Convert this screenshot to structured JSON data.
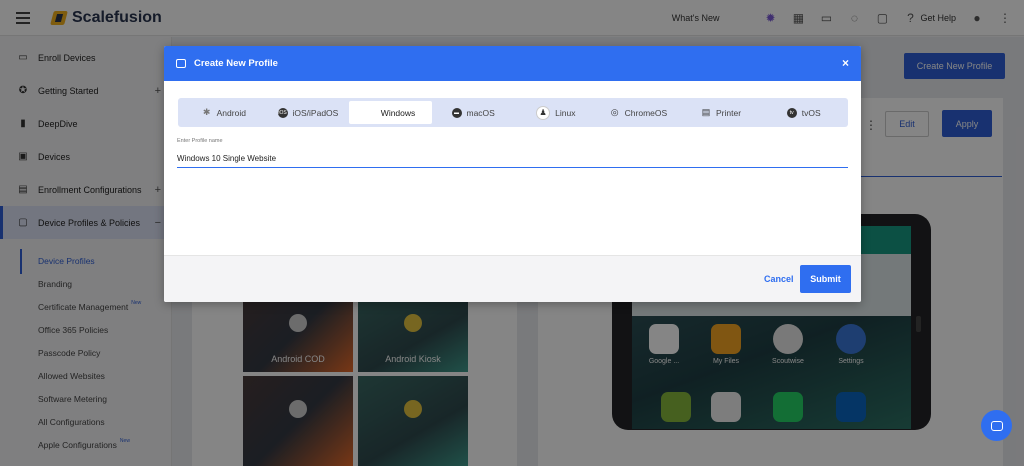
{
  "topbar": {
    "brand": "Scalefusion",
    "whats_new": "What's New",
    "help": "Get Help",
    "icons": [
      "hamburger-icon",
      "sparkle-icon",
      "grid-icon",
      "cast-icon",
      "loading-icon",
      "chat-icon",
      "help-icon",
      "account-icon",
      "more-icon"
    ]
  },
  "sidebar": {
    "items": [
      {
        "label": "Enroll Devices",
        "icon": "devices-icon"
      },
      {
        "label": "Getting Started",
        "icon": "star-icon"
      },
      {
        "label": "DeepDive",
        "icon": "bar-chart-icon"
      },
      {
        "label": "Devices",
        "icon": "monitor-icon"
      },
      {
        "label": "Enrollment Configurations",
        "icon": "enroll-icon"
      },
      {
        "label": "Device Profiles & Policies",
        "icon": "clipboard-icon"
      }
    ],
    "subitems": [
      {
        "label": "Device Profiles"
      },
      {
        "label": "Branding"
      },
      {
        "label": "Certificate Management",
        "badge": "New"
      },
      {
        "label": "Office 365 Policies"
      },
      {
        "label": "Passcode Policy"
      },
      {
        "label": "Allowed Websites"
      },
      {
        "label": "Software Metering"
      },
      {
        "label": "All Configurations"
      },
      {
        "label": "Apple Configurations",
        "badge": "New"
      }
    ]
  },
  "background": {
    "create_button": "Create New Profile",
    "edit_button": "Edit",
    "apply_button": "Apply",
    "tiles": [
      "Android COD",
      "Android Kiosk"
    ],
    "apps": [
      "Google ...",
      "My Files",
      "Scoutwise",
      "Settings"
    ]
  },
  "modal": {
    "title": "Create New Profile",
    "close": "×",
    "os_tabs": [
      {
        "label": "Android",
        "icon": "android-icon"
      },
      {
        "label": "iOS/iPadOS",
        "icon": "ios-icon"
      },
      {
        "label": "Windows",
        "icon": "windows-icon",
        "active": true
      },
      {
        "label": "macOS",
        "icon": "macos-icon"
      },
      {
        "label": "Linux",
        "icon": "linux-icon"
      },
      {
        "label": "ChromeOS",
        "icon": "chromeos-icon"
      },
      {
        "label": "Printer",
        "icon": "printer-icon"
      },
      {
        "label": "tvOS",
        "icon": "tvos-icon"
      }
    ],
    "field_label": "Enter Profile name",
    "field_value": "Windows 10 Single Website",
    "cancel": "Cancel",
    "submit": "Submit"
  },
  "colors": {
    "accent": "#2f6ef0",
    "sidebar_active_bg": "#dde3f5",
    "tab_bar_bg": "#dbe2f6"
  }
}
